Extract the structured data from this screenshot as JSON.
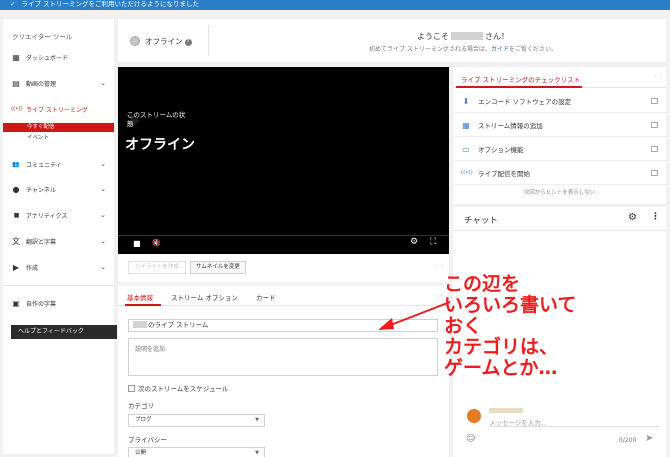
{
  "banner": {
    "text": "ライブ ストリーミングをご利用いただけるようになりました"
  },
  "sidebar": {
    "title": "クリエイター ツール",
    "items": [
      {
        "label": "ダッシュボード",
        "icon": "dashboard-icon",
        "glyph": "▦"
      },
      {
        "label": "動画の管理",
        "icon": "video-manager-icon",
        "glyph": "▤",
        "chevron": "⌄"
      },
      {
        "label": "ライブ ストリーミング",
        "icon": "live-icon",
        "glyph": "((•))"
      },
      {
        "label": "コミュニティ",
        "icon": "community-icon",
        "glyph": "👥",
        "chevron": "⌄"
      },
      {
        "label": "チャンネル",
        "icon": "channel-icon",
        "glyph": "●",
        "chevron": "⌄"
      },
      {
        "label": "アナリティクス",
        "icon": "analytics-icon",
        "glyph": "▮▮",
        "chevron": "⌄"
      },
      {
        "label": "翻訳と字幕",
        "icon": "translate-icon",
        "glyph": "文",
        "chevron": "⌄"
      },
      {
        "label": "作成",
        "icon": "create-icon",
        "glyph": "▶",
        "chevron": "⌄"
      },
      {
        "label": "自作の字幕",
        "icon": "subtitles-icon",
        "glyph": "▣"
      }
    ],
    "sub_items": [
      {
        "label": "今すぐ配信",
        "selected": true
      },
      {
        "label": "イベント",
        "selected": false
      }
    ],
    "feedback_label": "ヘルプとフィードバック"
  },
  "status": {
    "state": "オフライン",
    "help_glyph": "?",
    "welcome_prefix": "ようこそ",
    "welcome_suffix": "さん！",
    "sub_text": "初めてライブ ストリーミングされる場合は、",
    "guide_link": "ガイド",
    "sub_text_end": "をご覧ください。"
  },
  "video": {
    "state_label": "このストリームの状態",
    "state_value": "オフライン",
    "stop_glyph": "■",
    "mute_glyph": "🔇",
    "gear_glyph": "⚙",
    "fullscreen_glyph": "⛶"
  },
  "video_tools": {
    "highlight_label": "ハイライトを作成",
    "thumbnail_label": "サムネイルを変更"
  },
  "form": {
    "tabs": [
      "基本情報",
      "ストリーム オプション",
      "カード"
    ],
    "active_tab": 0,
    "title_value": "のライブ ストリーム",
    "description_placeholder": "説明を追加",
    "schedule_label": "次のストリームをスケジュール",
    "category_label": "カテゴリ",
    "category_value": "ブログ",
    "privacy_label": "プライバシー",
    "privacy_value": "公開"
  },
  "checklist": {
    "title": "ライブ ストリーミングのチェックリスト",
    "items": [
      {
        "label": "エンコード ソフトウェアの設定",
        "icon": "download-icon",
        "glyph": "⬇"
      },
      {
        "label": "ストリーム情報の追加",
        "icon": "info-card-icon",
        "glyph": "▦"
      },
      {
        "label": "オプション機能",
        "icon": "card-icon",
        "glyph": "▭"
      },
      {
        "label": "ライブ配信を開始",
        "icon": "broadcast-icon",
        "glyph": "((•))"
      }
    ],
    "hint": "次回からヒントを表示しない"
  },
  "chat": {
    "title": "チャット",
    "input_placeholder": "メッセージを入力...",
    "counter": "0/200",
    "gear_glyph": "⚙",
    "more_glyph": "⋮",
    "emoji_glyph": "☺",
    "send_glyph": "➤"
  },
  "annotation": {
    "lines": [
      "この辺を",
      "いろいろ書いて",
      "おく",
      "カテゴリは、",
      "ゲームとか…"
    ],
    "color": "#ee1c1c"
  },
  "colors": {
    "accent": "#cc1818",
    "link": "#2a6fc9",
    "banner": "#2a7ec8"
  }
}
